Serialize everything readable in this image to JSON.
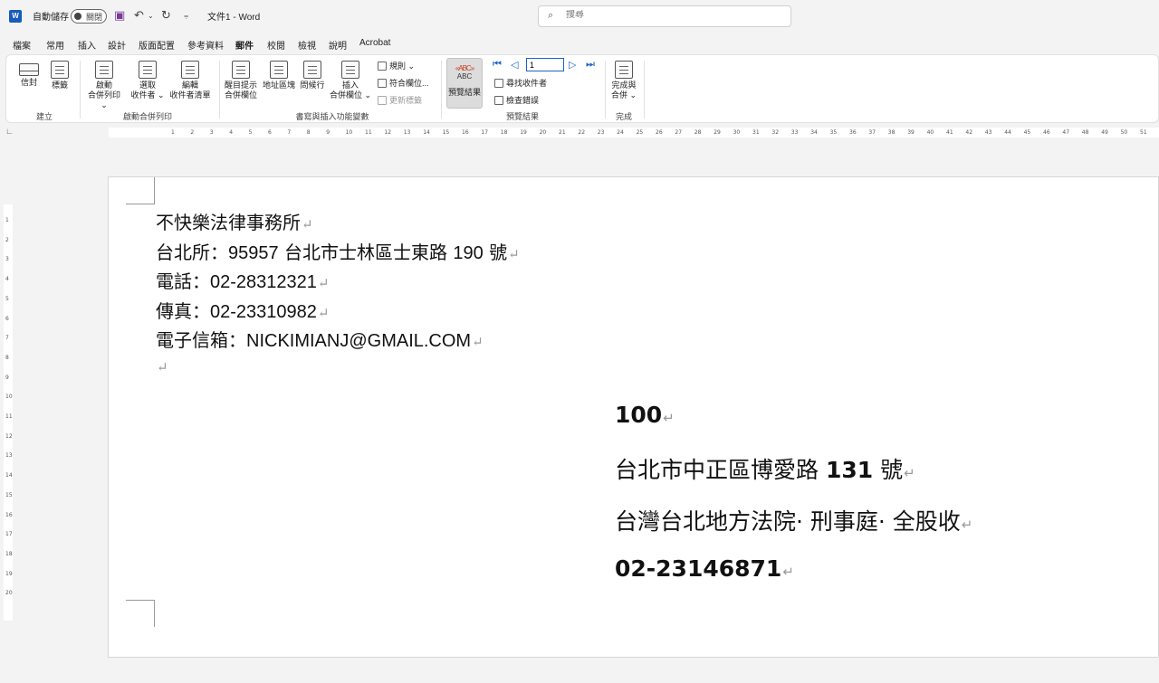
{
  "titlebar": {
    "autosave_label": "自動儲存",
    "autosave_state": "關閉",
    "document_title": "文件1 - Word",
    "search_placeholder": "搜尋"
  },
  "menu": {
    "tabs": [
      "檔案",
      "常用",
      "插入",
      "設計",
      "版面配置",
      "參考資料",
      "郵件",
      "校閱",
      "檢視",
      "說明",
      "Acrobat"
    ],
    "active": "郵件"
  },
  "ribbon": {
    "create": {
      "label": "建立",
      "envelopes": "信封",
      "labels": "標籤"
    },
    "start_merge": {
      "label": "啟動合併列印",
      "start": [
        "啟動",
        "合併列印 ⌄"
      ],
      "select_recipients": [
        "選取",
        "收件者 ⌄"
      ],
      "edit_list": [
        "編輯",
        "收件者清單"
      ]
    },
    "write_insert": {
      "label": "書寫與插入功能變數",
      "highlight": [
        "醒目提示",
        "合併欄位"
      ],
      "address_block": "地址區塊",
      "greeting_line": "問候行",
      "insert_field": [
        "插入",
        "合併欄位 ⌄"
      ],
      "rules": "規則 ⌄",
      "match_fields": "符合欄位...",
      "update_labels": "更新標籤"
    },
    "preview": {
      "label": "預覽結果",
      "button": "預覽結果",
      "abc": "ABC",
      "record": "1",
      "find_recipient": "尋找收件者",
      "check_errors": "檢查錯誤"
    },
    "finish": {
      "label": "完成",
      "finish_merge": [
        "完成與",
        "合併 ⌄"
      ]
    }
  },
  "document": {
    "sender": {
      "line1": "不快樂法律事務所",
      "line2_prefix": "台北所：",
      "line2_zip": "95957",
      "line2_addr": " 台北市士林區士東路 ",
      "line2_num": "190",
      "line2_suffix": " 號",
      "phone_label": "電話：",
      "phone": "02-28312321",
      "fax_label": "傳真：",
      "fax": "02-23310982",
      "email_label": "電子信箱：",
      "email": "NICKIMIANJ@GMAIL.COM"
    },
    "recipient": {
      "zip": "100",
      "address_prefix": "台北市中正區博愛路 ",
      "address_number": "131",
      "address_suffix": " 號",
      "name": "台灣台北地方法院· 刑事庭· 全股收",
      "phone": "02-23146871"
    },
    "paragraph_mark": "↵"
  },
  "ruler": {
    "h_ticks": [
      "1",
      "2",
      "3",
      "4",
      "5",
      "6",
      "7",
      "8",
      "9",
      "10",
      "11",
      "12",
      "13",
      "14",
      "15",
      "16",
      "17",
      "18",
      "19",
      "20",
      "21",
      "22",
      "23",
      "24",
      "25",
      "26",
      "27",
      "28",
      "29",
      "30",
      "31",
      "32",
      "33",
      "34",
      "35",
      "36",
      "37",
      "38",
      "39",
      "40",
      "41",
      "42",
      "43",
      "44",
      "45",
      "46",
      "47",
      "48",
      "49",
      "50",
      "51"
    ],
    "v_ticks": [
      "1",
      "2",
      "3",
      "4",
      "5",
      "6",
      "7",
      "8",
      "9",
      "10",
      "11",
      "12",
      "13",
      "14",
      "15",
      "16",
      "17",
      "18",
      "19",
      "20"
    ]
  }
}
